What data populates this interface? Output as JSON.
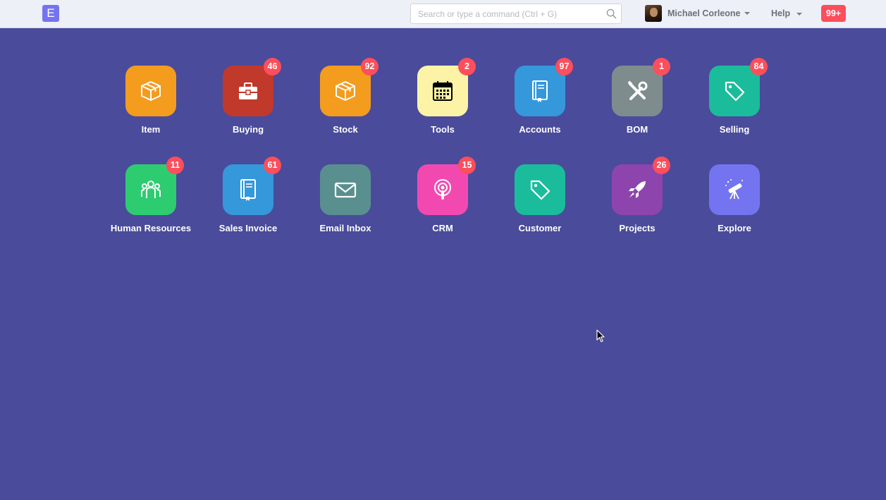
{
  "navbar": {
    "logo_letter": "E",
    "search_placeholder": "Search or type a command (Ctrl + G)",
    "user_name": "Michael Corleone",
    "help_label": "Help",
    "notifications_count": "99+"
  },
  "modules": [
    {
      "label": "Item",
      "badge": "",
      "color": "#f39c1e",
      "icon": "box-icon"
    },
    {
      "label": "Buying",
      "badge": "46",
      "color": "#c0392b",
      "icon": "briefcase-icon"
    },
    {
      "label": "Stock",
      "badge": "92",
      "color": "#f39c1e",
      "icon": "box-icon"
    },
    {
      "label": "Tools",
      "badge": "2",
      "color": "#fcf3a6",
      "icon": "calendar-icon"
    },
    {
      "label": "Accounts",
      "badge": "97",
      "color": "#3498db",
      "icon": "book-icon"
    },
    {
      "label": "BOM",
      "badge": "1",
      "color": "#7f8c8d",
      "icon": "tools-icon"
    },
    {
      "label": "Selling",
      "badge": "84",
      "color": "#1abc9c",
      "icon": "tag-icon"
    },
    {
      "label": "Human Resources",
      "badge": "11",
      "color": "#2ecc71",
      "icon": "people-icon"
    },
    {
      "label": "Sales Invoice",
      "badge": "61",
      "color": "#3498db",
      "icon": "book-icon"
    },
    {
      "label": "Email Inbox",
      "badge": "",
      "color": "#5a8f8f",
      "icon": "envelope-icon"
    },
    {
      "label": "CRM",
      "badge": "15",
      "color": "#f249b1",
      "icon": "podcast-icon"
    },
    {
      "label": "Customer",
      "badge": "",
      "color": "#1abc9c",
      "icon": "tag-icon"
    },
    {
      "label": "Projects",
      "badge": "26",
      "color": "#8e44ad",
      "icon": "rocket-icon"
    },
    {
      "label": "Explore",
      "badge": "",
      "color": "#7574f0",
      "icon": "telescope-icon"
    }
  ]
}
